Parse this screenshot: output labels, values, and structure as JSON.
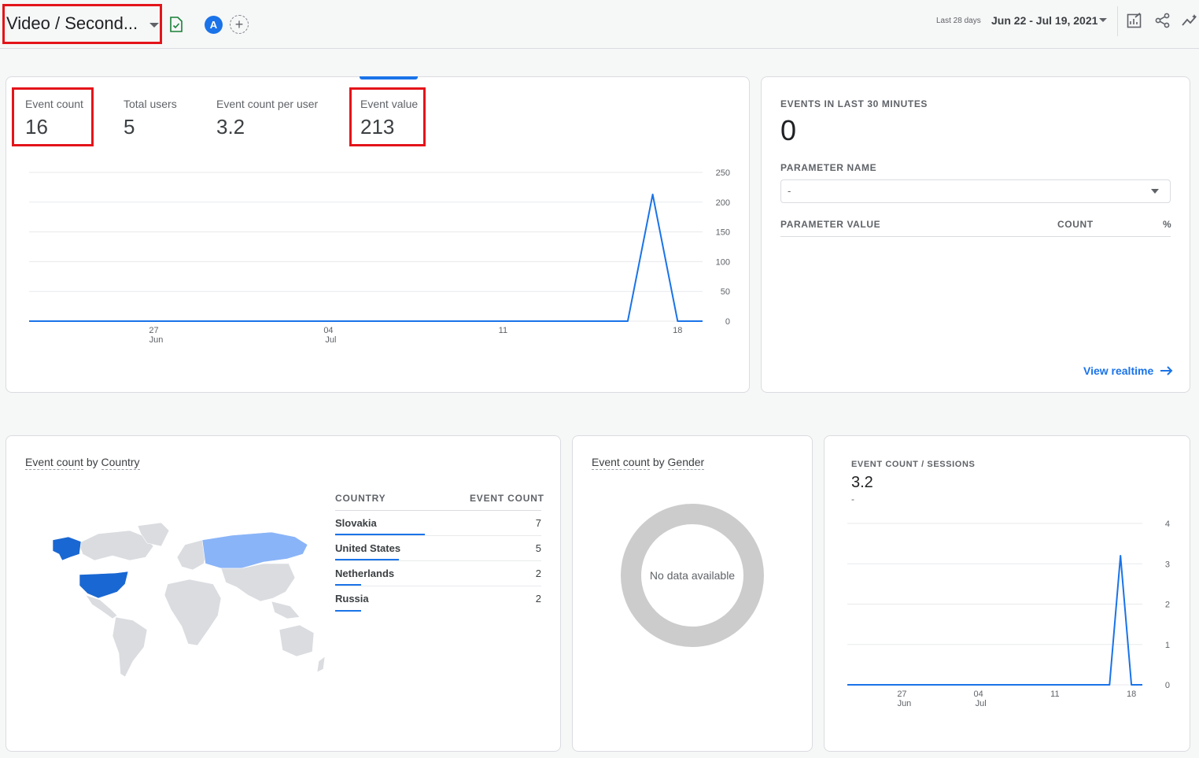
{
  "header": {
    "report_title": "Video / Second...",
    "avatar_letter": "A",
    "add_comparison": "+",
    "date_label": "Last 28 days",
    "date_range": "Jun 22 - Jul 19, 2021"
  },
  "metrics": [
    {
      "label": "Event count",
      "value": "16"
    },
    {
      "label": "Total users",
      "value": "5"
    },
    {
      "label": "Event count per user",
      "value": "3.2"
    },
    {
      "label": "Event value",
      "value": "213"
    }
  ],
  "main_chart": {
    "y_ticks": [
      "250",
      "200",
      "150",
      "100",
      "50",
      "0"
    ],
    "x_ticks": [
      {
        "day": "27",
        "month": "Jun"
      },
      {
        "day": "04",
        "month": "Jul"
      },
      {
        "day": "11",
        "month": ""
      },
      {
        "day": "18",
        "month": ""
      }
    ]
  },
  "realtime": {
    "heading": "EVENTS IN LAST 30 MINUTES",
    "value": "0",
    "param_name_label": "PARAMETER NAME",
    "param_select_value": "-",
    "col_param_value": "PARAMETER VALUE",
    "col_count": "COUNT",
    "col_percent": "%",
    "view_realtime": "View realtime"
  },
  "country_card": {
    "title_prefix": "Event count",
    "title_by": "by",
    "title_dim": "Country",
    "col_country": "COUNTRY",
    "col_event_count": "EVENT COUNT",
    "rows": [
      {
        "name": "Slovakia",
        "value": "7",
        "share": 1.0
      },
      {
        "name": "United States",
        "value": "5",
        "share": 0.71
      },
      {
        "name": "Netherlands",
        "value": "2",
        "share": 0.29
      },
      {
        "name": "Russia",
        "value": "2",
        "share": 0.29
      }
    ]
  },
  "gender_card": {
    "title_prefix": "Event count",
    "title_by": "by",
    "title_dim": "Gender",
    "no_data": "No data available"
  },
  "sessions_card": {
    "heading": "EVENT COUNT / SESSIONS",
    "value": "3.2",
    "sub": "-",
    "y_ticks": [
      "4",
      "3",
      "2",
      "1",
      "0"
    ],
    "x_ticks": [
      {
        "day": "27",
        "month": "Jun"
      },
      {
        "day": "04",
        "month": "Jul"
      },
      {
        "day": "11",
        "month": ""
      },
      {
        "day": "18",
        "month": ""
      }
    ]
  },
  "chart_data": [
    {
      "type": "line",
      "x": [
        "Jun 22",
        "Jun 23",
        "Jun 24",
        "Jun 25",
        "Jun 26",
        "Jun 27",
        "Jun 28",
        "Jun 29",
        "Jun 30",
        "Jul 1",
        "Jul 2",
        "Jul 3",
        "Jul 4",
        "Jul 5",
        "Jul 6",
        "Jul 7",
        "Jul 8",
        "Jul 9",
        "Jul 10",
        "Jul 11",
        "Jul 12",
        "Jul 13",
        "Jul 14",
        "Jul 15",
        "Jul 16",
        "Jul 17",
        "Jul 18",
        "Jul 19"
      ],
      "series": [
        {
          "values": [
            0,
            0,
            0,
            0,
            0,
            0,
            0,
            0,
            0,
            0,
            0,
            0,
            0,
            0,
            0,
            0,
            0,
            0,
            0,
            0,
            0,
            0,
            0,
            0,
            0,
            213,
            0,
            0
          ]
        }
      ],
      "ylim": [
        0,
        250
      ],
      "y_axis_side": "right",
      "grid": true
    },
    {
      "type": "line",
      "x": [
        "Jun 22",
        "Jun 23",
        "Jun 24",
        "Jun 25",
        "Jun 26",
        "Jun 27",
        "Jun 28",
        "Jun 29",
        "Jun 30",
        "Jul 1",
        "Jul 2",
        "Jul 3",
        "Jul 4",
        "Jul 5",
        "Jul 6",
        "Jul 7",
        "Jul 8",
        "Jul 9",
        "Jul 10",
        "Jul 11",
        "Jul 12",
        "Jul 13",
        "Jul 14",
        "Jul 15",
        "Jul 16",
        "Jul 17",
        "Jul 18",
        "Jul 19"
      ],
      "series": [
        {
          "values": [
            0,
            0,
            0,
            0,
            0,
            0,
            0,
            0,
            0,
            0,
            0,
            0,
            0,
            0,
            0,
            0,
            0,
            0,
            0,
            0,
            0,
            0,
            0,
            0,
            0,
            3.2,
            0,
            0
          ]
        }
      ],
      "ylim": [
        0,
        4
      ],
      "y_axis_side": "right",
      "grid": true
    }
  ],
  "colors": {
    "accent": "#1a73e8",
    "highlight_box": "#e3141a",
    "map_high": "#1967d2",
    "map_low": "#8ab4f8",
    "map_none": "#dadce0"
  }
}
